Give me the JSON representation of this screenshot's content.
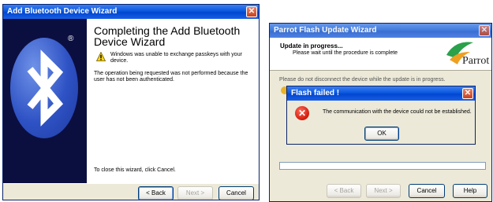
{
  "wizard": {
    "title": "Add Bluetooth Device Wizard",
    "registered_mark": "®",
    "heading": "Completing the Add Bluetooth Device Wizard",
    "warning": "Windows was unable to exchange passkeys with your device.",
    "info": "The operation being requested was not performed because the user has not been authenticated.",
    "close_hint": "To close this wizard, click Cancel.",
    "buttons": {
      "back": "< Back",
      "next": "Next >",
      "cancel": "Cancel"
    },
    "close_glyph": "✕"
  },
  "flash": {
    "title": "Parrot Flash Update Wizard",
    "header_title": "Update in progress...",
    "header_sub": "Please wait until the procedure is complete",
    "logo_word": "Parrot",
    "body_text": "Please do not disconnect the device while the update is in progress.",
    "progress": 0,
    "buttons": {
      "back": "< Back",
      "next": "Next >",
      "cancel": "Cancel",
      "help": "Help"
    },
    "close_glyph": "✕"
  },
  "dialog": {
    "title": "Flash failed !",
    "message": "The communication with the device could not be established.",
    "ok": "OK",
    "close_glyph": "✕",
    "error_glyph": "✕"
  },
  "colors": {
    "titlebar_blue": "#0a58e0",
    "wizard_panel": "#0b0f40",
    "error_red": "#d21a0b",
    "parrot_green": "#2aa14a",
    "parrot_orange": "#f0a020"
  }
}
